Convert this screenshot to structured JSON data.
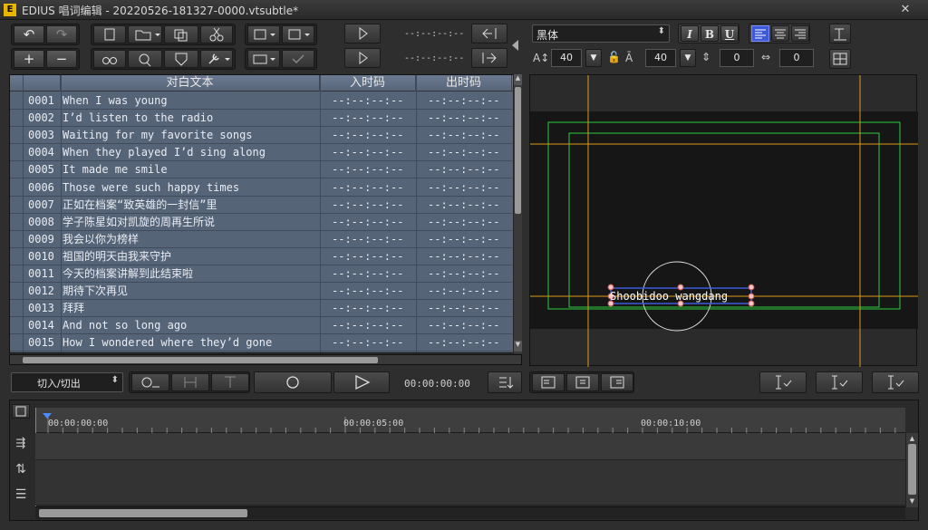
{
  "window": {
    "title": "EDIUS 唱词编辑 - 20220526-181327-0000.vtsubtle*",
    "close_label": "✕"
  },
  "toolbar": {
    "undo_icon": "↶",
    "redo_icon": "↷",
    "add_icon": "+",
    "remove_icon": "−",
    "in_timecode": "--:--:--:--",
    "out_timecode": "--:--:--:--"
  },
  "text_panel": {
    "font_name": "黑体",
    "italic_label": "I",
    "bold_label": "B",
    "underline_label": "U",
    "font_size": "40",
    "line_height": "40",
    "char_spacing": "0",
    "line_spacing": "0"
  },
  "table": {
    "headers": {
      "text": "对白文本",
      "in": "入时码",
      "out": "出时码"
    },
    "rows": [
      {
        "id": "0001",
        "text": "When I was young",
        "in": "--:--:--:--",
        "out": "--:--:--:--"
      },
      {
        "id": "0002",
        "text": "I’d listen to the radio",
        "in": "--:--:--:--",
        "out": "--:--:--:--"
      },
      {
        "id": "0003",
        "text": "Waiting for my favorite songs",
        "in": "--:--:--:--",
        "out": "--:--:--:--"
      },
      {
        "id": "0004",
        "text": "When they played I’d sing along",
        "in": "--:--:--:--",
        "out": "--:--:--:--"
      },
      {
        "id": "0005",
        "text": "It made me smile",
        "in": "--:--:--:--",
        "out": "--:--:--:--"
      },
      {
        "id": "0006",
        "text": "Those were such happy times",
        "in": "--:--:--:--",
        "out": "--:--:--:--"
      },
      {
        "id": "0007",
        "text": "正如在档案“致英雄的一封信”里",
        "in": "--:--:--:--",
        "out": "--:--:--:--"
      },
      {
        "id": "0008",
        "text": "学子陈星如对凯旋的周再生所说",
        "in": "--:--:--:--",
        "out": "--:--:--:--"
      },
      {
        "id": "0009",
        "text": "我会以你为榜样",
        "in": "--:--:--:--",
        "out": "--:--:--:--"
      },
      {
        "id": "0010",
        "text": "祖国的明天由我来守护",
        "in": "--:--:--:--",
        "out": "--:--:--:--"
      },
      {
        "id": "0011",
        "text": "今天的档案讲解到此结束啦",
        "in": "--:--:--:--",
        "out": "--:--:--:--"
      },
      {
        "id": "0012",
        "text": "期待下次再见",
        "in": "--:--:--:--",
        "out": "--:--:--:--"
      },
      {
        "id": "0013",
        "text": "拜拜",
        "in": "--:--:--:--",
        "out": "--:--:--:--"
      },
      {
        "id": "0014",
        "text": "And not so long ago",
        "in": "--:--:--:--",
        "out": "--:--:--:--"
      },
      {
        "id": "0015",
        "text": "How I wondered where they’d gone",
        "in": "--:--:--:--",
        "out": "--:--:--:--"
      }
    ]
  },
  "preview": {
    "caption_text": "Shoobidoo wangdang"
  },
  "controls": {
    "mode_select": "切入/切出",
    "timecode": "00:00:00:00"
  },
  "timeline": {
    "ticks": [
      "00:00:00:00",
      "00:00:05:00",
      "00:00:10:00"
    ]
  },
  "colors": {
    "table_bg": "#566478",
    "safe_line": "#e39a1a",
    "safe_box": "#2ecc40",
    "selection": "#3c5ad8"
  }
}
